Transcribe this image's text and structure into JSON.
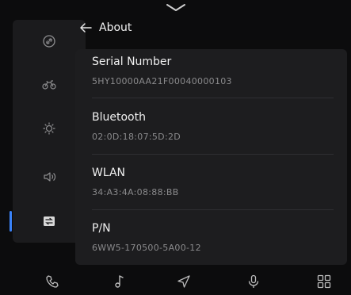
{
  "header": {
    "title": "About"
  },
  "rows": [
    {
      "label": "Serial Number",
      "value": "5HY10000AA21F00040000103"
    },
    {
      "label": "Bluetooth",
      "value": "02:0D:18:07:5D:2D"
    },
    {
      "label": "WLAN",
      "value": "34:A3:4A:08:88:BB"
    },
    {
      "label": "P/N",
      "value": "6WW5-170500-5A00-12"
    }
  ],
  "sidebar": {
    "items": [
      {
        "icon": "link-icon"
      },
      {
        "icon": "bike-icon"
      },
      {
        "icon": "brightness-icon"
      },
      {
        "icon": "volume-icon"
      },
      {
        "icon": "settings-transfer-icon",
        "active": true
      }
    ]
  },
  "bottom_nav": [
    {
      "icon": "phone-icon"
    },
    {
      "icon": "music-icon"
    },
    {
      "icon": "navigation-icon"
    },
    {
      "icon": "microphone-icon"
    },
    {
      "icon": "apps-grid-icon"
    }
  ],
  "colors": {
    "accent": "#3a82f7",
    "background": "#0c0c0d",
    "panel": "#1d1d1f"
  }
}
